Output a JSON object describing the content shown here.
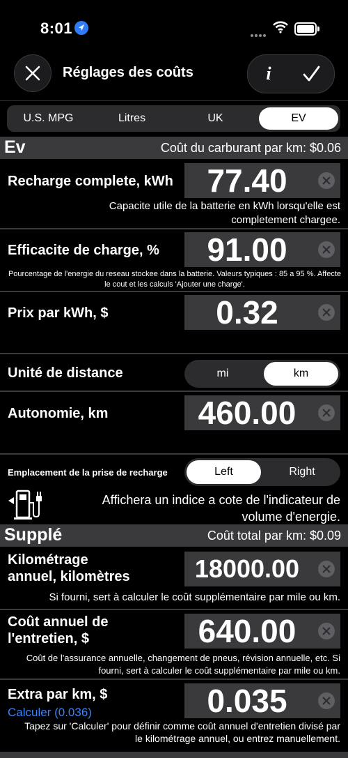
{
  "status": {
    "time": "8:01"
  },
  "nav": {
    "title": "Réglages des coûts",
    "info_label": "i"
  },
  "segments": [
    "U.S. MPG",
    "Litres",
    "UK",
    "EV"
  ],
  "selected_segment": "EV",
  "ev_section": {
    "title": "Ev",
    "info": "Coût du carburant par km: $0.06"
  },
  "fields": {
    "recharge": {
      "label": "Recharge complete, kWh",
      "value": "77.40",
      "desc": "Capacite utile de la batterie en kWh lorsqu'elle est completement chargee."
    },
    "efficacite": {
      "label": "Efficacite de charge, %",
      "value": "91.00",
      "desc": "Pourcentage de l'energie du reseau stockee dans la batterie. Valeurs typiques : 85 a 95 %. Affecte le cout et les calculs 'Ajouter une charge'."
    },
    "prix": {
      "label": "Prix par kWh, $",
      "value": "0.32"
    },
    "distance_unit": {
      "label": "Unité de distance",
      "options": [
        "mi",
        "km"
      ],
      "selected": "km"
    },
    "autonomie": {
      "label": "Autonomie, km",
      "value": "460.00"
    },
    "prise": {
      "label": "Emplacement de la prise de recharge",
      "options": [
        "Left",
        "Right"
      ],
      "selected": "Left",
      "desc": "Affichera un indice a cote de l'indicateur de volume d'energie."
    }
  },
  "supple_section": {
    "title": "Supplé",
    "info": "Coût total par km: $0.09"
  },
  "supple_fields": {
    "kilometrage": {
      "label_line1": "Kilométrage",
      "label_line2": "annuel, kilomètres",
      "value": "18000.00",
      "desc": "Si fourni, sert à calculer le coût supplémentaire par mile ou km."
    },
    "entretien": {
      "label_line1": "Coût annuel de",
      "label_line2": "l'entretien, $",
      "value": "640.00",
      "desc": "Coût de l'assurance annuelle, changement de pneus, révision annuelle, etc. Si fourni, sert à calculer le coût supplémentaire par mile ou km."
    },
    "extra": {
      "label": "Extra par km, $",
      "link": "Calculer (0.036)",
      "value": "0.035",
      "desc": "Tapez sur 'Calculer' pour définir comme coût annuel d'entretien divisé par le kilométrage annuel, ou entrez manuellement."
    }
  },
  "colors": {
    "accent": "#3b82f6",
    "background": "#000000",
    "panel": "#3a3a3c"
  }
}
